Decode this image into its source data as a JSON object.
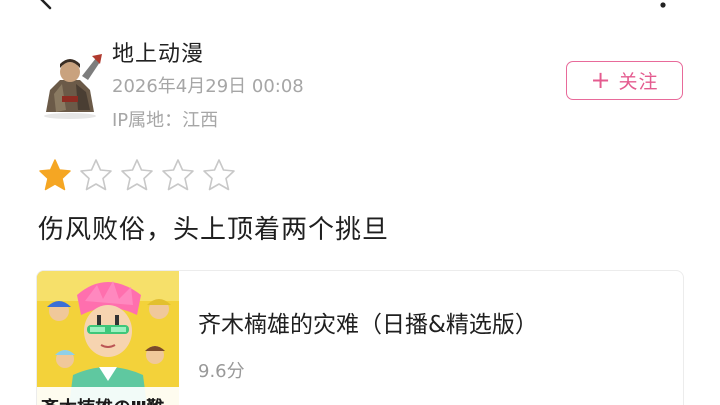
{
  "topbar": {
    "back_icon": "back-chevron-icon",
    "more_icon": "more-dots-icon"
  },
  "post": {
    "username": "地上动漫",
    "time": "2026年4月29日 00:08",
    "ip_location": "IP属地：江西",
    "follow": {
      "plus": "+",
      "label": "关注"
    },
    "avatar_icon": "warrior-avatar"
  },
  "review": {
    "rating": 1,
    "max_rating": 5,
    "text": "伤风败俗，头上顶着两个挑旦"
  },
  "work": {
    "title": "齐木楠雄的灾难（日播&精选版）",
    "score": "9.6分",
    "cover_caption": "斉木楠雄のΨ難"
  },
  "colors": {
    "accent_pink": "#e45b8f",
    "star_filled": "#f5a623",
    "star_empty": "#c8c8c8",
    "meta_gray": "#a6a6a6"
  }
}
